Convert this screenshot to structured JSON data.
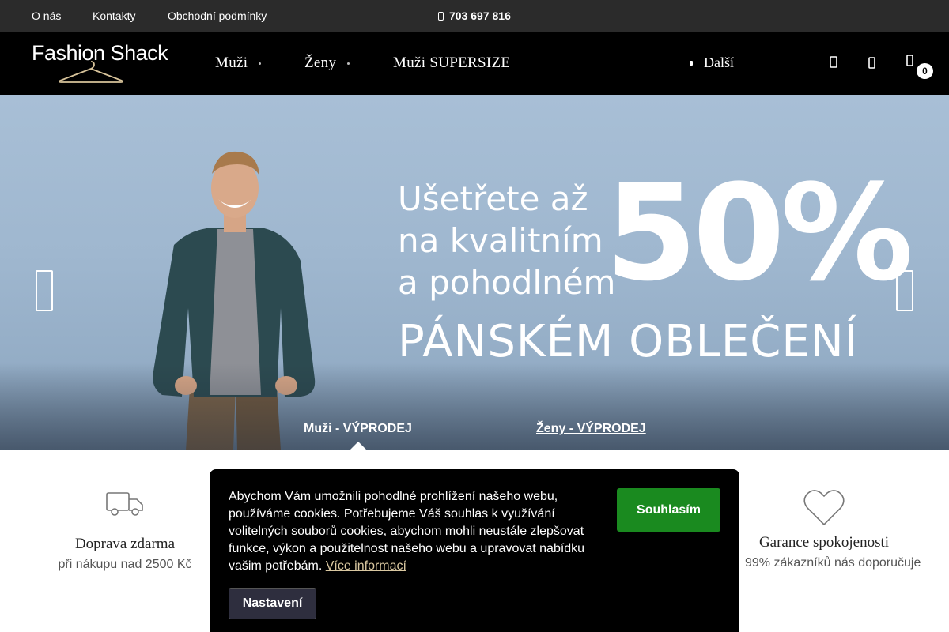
{
  "topbar": {
    "links": [
      "O nás",
      "Kontakty",
      "Obchodní podmínky"
    ],
    "phone": "703 697 816"
  },
  "header": {
    "logo_text": "Fashion Shack",
    "nav": [
      "Muži",
      "Ženy",
      "Muži SUPERSIZE"
    ],
    "more": "Další",
    "cart_count": "0",
    "icons": [
      "search-icon",
      "user-icon",
      "cart-icon"
    ]
  },
  "hero": {
    "headline": [
      "Ušetřete až",
      "na kvalitním",
      "a pohodlném"
    ],
    "percent": "50%",
    "subline": "PÁNSKÉM OBLEČENÍ",
    "tabs": [
      "Muži - VÝPRODEJ",
      "Ženy - VÝPRODEJ"
    ],
    "active_tab": 0
  },
  "features": [
    {
      "icon": "truck-icon",
      "title": "Doprava zdarma",
      "subtitle": "při nákupu nad 2500 Kč"
    },
    {
      "icon": "heart-icon",
      "title": "Garance spokojenosti",
      "subtitle": "99% zákazníků nás doporučuje"
    }
  ],
  "cookie": {
    "text": "Abychom Vám umožnili pohodlné prohlížení našeho webu, používáme cookies. Potřebujeme Váš souhlas k využívání volitelných souborů cookies, abychom mohli neustále zlepšovat funkce, výkon a použitelnost našeho webu a upravovat nabídku vašim potřebám.",
    "more_link": "Více informací",
    "accept": "Souhlasím",
    "settings": "Nastavení"
  },
  "colors": {
    "topbar_bg": "#2b2b2b",
    "header_bg": "#000000",
    "accept_green": "#1a8a1f",
    "link_gold": "#d9c7a0"
  }
}
